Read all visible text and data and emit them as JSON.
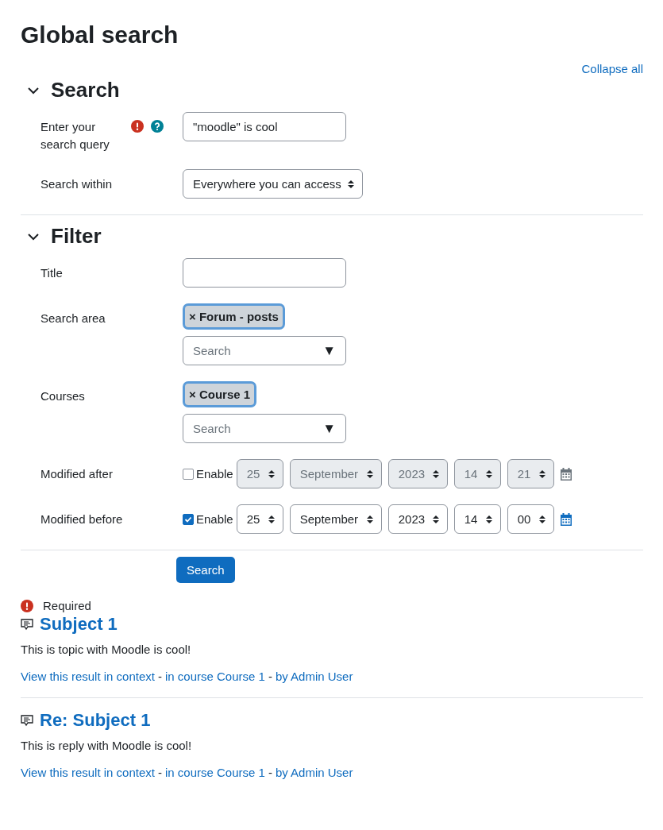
{
  "page_title": "Global search",
  "collapse_all": "Collapse all",
  "sections": [
    {
      "title": "Search",
      "expanded": true,
      "fields": [
        {
          "kind": "text",
          "label": "Enter your search query",
          "required": true,
          "help": true,
          "value": "\"moodle\" is cool"
        },
        {
          "kind": "select",
          "label": "Search within",
          "value": "Everywhere you can access"
        }
      ]
    },
    {
      "title": "Filter",
      "expanded": true,
      "fields": [
        {
          "kind": "text",
          "label": "Title"
        },
        {
          "kind": "autocomplete",
          "label": "Search area",
          "remove_mark": "×",
          "chips": [
            "Forum - posts"
          ],
          "placeholder": "Search",
          "arrow": "▼"
        },
        {
          "kind": "autocomplete",
          "label": "Courses",
          "remove_mark": "×",
          "chips": [
            "Course 1"
          ],
          "placeholder": "Search",
          "arrow": "▼"
        },
        {
          "kind": "date",
          "label": "Modified after",
          "enabled": false,
          "enable_label": "Enable",
          "parts": [
            "25",
            "September",
            "2023",
            "14",
            "21"
          ]
        },
        {
          "kind": "date",
          "label": "Modified before",
          "enabled": true,
          "enable_label": "Enable",
          "parts": [
            "25",
            "September",
            "2023",
            "14",
            "00"
          ]
        }
      ]
    }
  ],
  "submit": "Search",
  "required_note": "Required",
  "results": [
    {
      "title": "Subject 1",
      "content": "This is topic with Moodle is cool!",
      "meta": [
        {
          "kind": "link",
          "text": "View this result in context"
        },
        {
          "kind": "separator",
          "text": "-"
        },
        {
          "kind": "link",
          "text": "in course Course 1"
        },
        {
          "kind": "separator",
          "text": "-"
        },
        {
          "kind": "link",
          "text": "by Admin User"
        }
      ]
    },
    {
      "title": "Re: Subject 1",
      "content": "This is reply with Moodle is cool!",
      "meta": [
        {
          "kind": "link",
          "text": "View this result in context"
        },
        {
          "kind": "separator",
          "text": "-"
        },
        {
          "kind": "link",
          "text": "in course Course 1"
        },
        {
          "kind": "separator",
          "text": "-"
        },
        {
          "kind": "link",
          "text": "by Admin User"
        }
      ]
    }
  ]
}
